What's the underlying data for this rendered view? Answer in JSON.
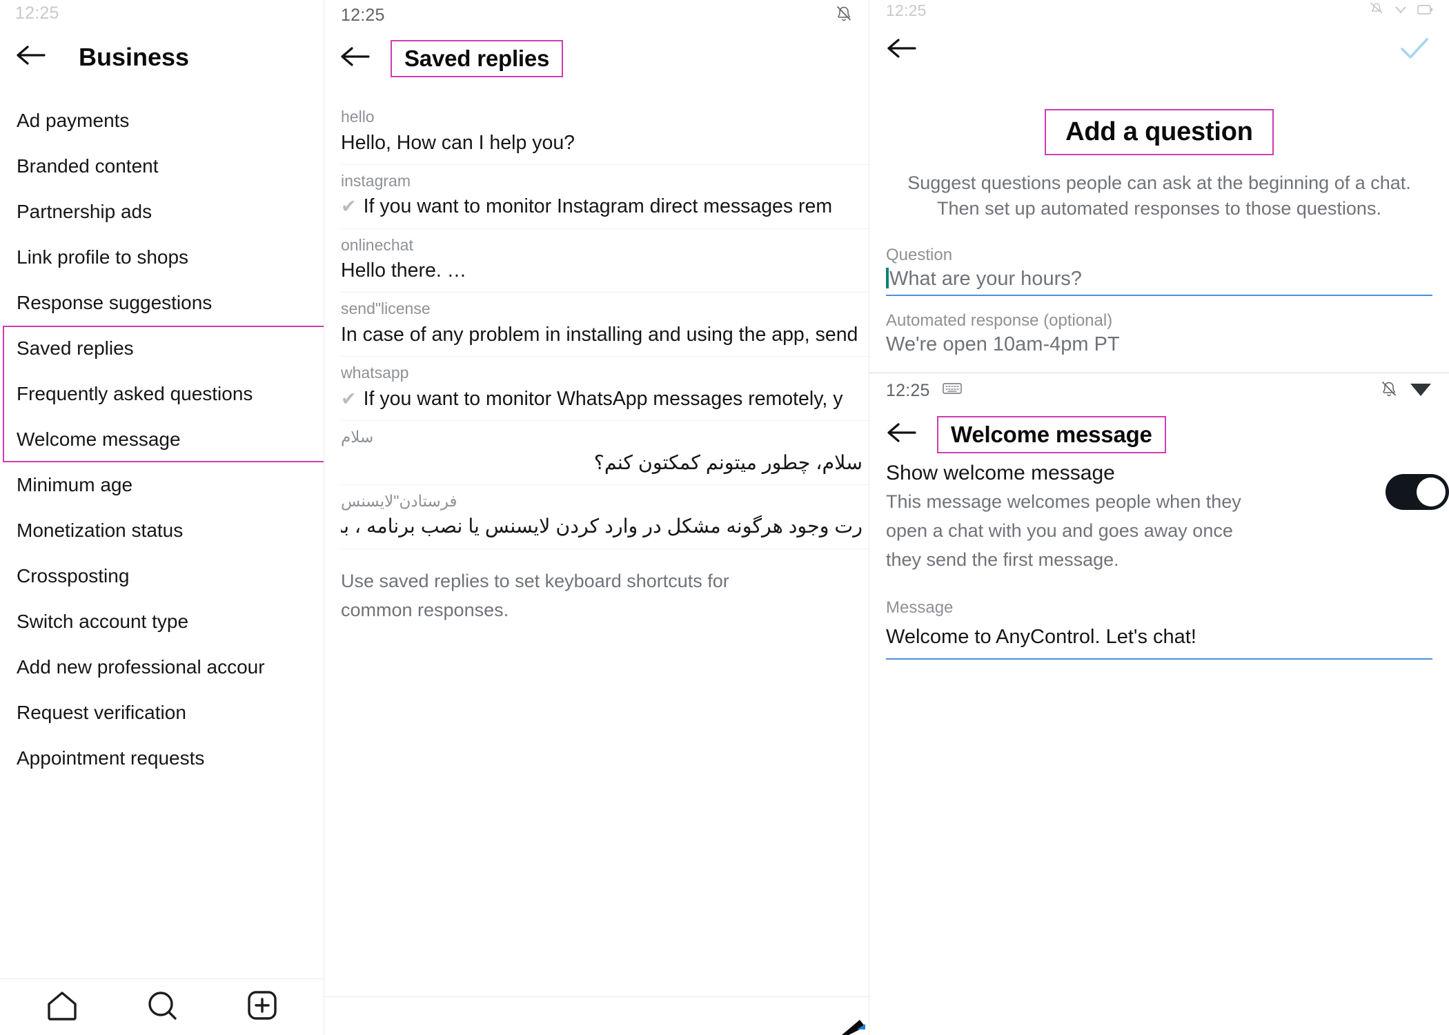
{
  "left_panel": {
    "header": {
      "title": "Business",
      "back_icon": "back-arrow-icon"
    },
    "items": [
      {
        "label": "Ad payments"
      },
      {
        "label": "Branded content"
      },
      {
        "label": "Partnership ads"
      },
      {
        "label": "Link profile to shops"
      },
      {
        "label": "Response suggestions"
      },
      {
        "label": "Saved replies",
        "highlighted": true
      },
      {
        "label": "Frequently asked questions",
        "highlighted": true
      },
      {
        "label": "Welcome message",
        "highlighted": true
      },
      {
        "label": "Minimum age"
      },
      {
        "label": "Monetization status"
      },
      {
        "label": "Crossposting"
      },
      {
        "label": "Switch account type"
      },
      {
        "label": "Add new professional accour"
      },
      {
        "label": "Request verification"
      },
      {
        "label": "Appointment requests"
      }
    ],
    "bottom_nav": [
      {
        "icon": "home-icon"
      },
      {
        "icon": "search-circle-icon"
      },
      {
        "icon": "add-box-icon"
      }
    ],
    "highlight_color": "#cf3bb3"
  },
  "mid_panel": {
    "statusbar": {
      "time": "12:25",
      "icons": [
        "bell-off-icon"
      ]
    },
    "header": {
      "title": "Saved replies",
      "back_icon": "back-arrow-icon"
    },
    "replies": [
      {
        "shortcut": "hello",
        "text": "Hello, How can I help you?",
        "tick": false,
        "rtl": false
      },
      {
        "shortcut": "instagram",
        "text": "If you want to monitor Instagram direct messages rem",
        "tick": true,
        "rtl": false
      },
      {
        "shortcut": "onlinechat",
        "text": "Hello there. …",
        "tick": false,
        "rtl": false
      },
      {
        "shortcut": "send\"license",
        "text": "In case of any problem in installing and using the app, send",
        "tick": false,
        "rtl": false
      },
      {
        "shortcut": "whatsapp",
        "text": "If you want to monitor WhatsApp messages remotely, y",
        "tick": true,
        "rtl": false
      },
      {
        "shortcut": "سلام",
        "text": "سلام، چطور میتونم کمکتون کنم؟",
        "tick": false,
        "rtl": true
      },
      {
        "shortcut": "فرستادن\"لایسنس",
        "text": "رت وجود هرگونه مشکل در وارد کردن لایسنس یا نصب برنامه ، به واح…",
        "tick": false,
        "rtl": true
      }
    ],
    "footer": "Use saved replies to set keyboard shortcuts for common responses."
  },
  "right_panel": {
    "statusbar_top": {
      "time": "12:25"
    },
    "add_question": {
      "back_icon": "back-arrow-icon",
      "confirm_icon": "check-icon",
      "confirm_color": "#a8d4f0",
      "title": "Add a question",
      "description": "Suggest questions people can ask at the beginning of a chat. Then set up automated responses to those questions.",
      "question_label": "Question",
      "question_placeholder": "What are your hours?",
      "response_label": "Automated response (optional)",
      "response_placeholder": "We're open 10am-4pm PT",
      "underline_color": "#4a90d9",
      "caret_color": "#0c8374"
    },
    "welcome_message": {
      "statusbar": {
        "time": "12:25",
        "icons": [
          "keyboard-icon",
          "bell-off-icon",
          "wifi-icon"
        ]
      },
      "back_icon": "back-arrow-icon",
      "title": "Welcome message",
      "toggle_title": "Show welcome message",
      "toggle_description": "This message welcomes people when they open a chat with you and goes away once they send the first message.",
      "toggle_on": true,
      "message_label": "Message",
      "message_value": "Welcome to AnyControl. Let's chat!",
      "underline_color": "#4a90d9"
    }
  }
}
